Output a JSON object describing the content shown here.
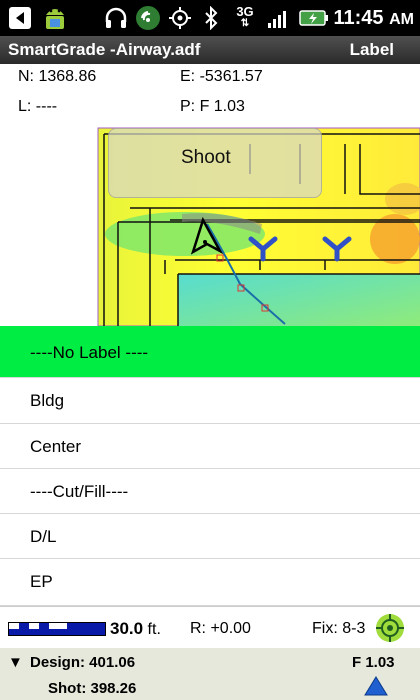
{
  "status_bar": {
    "time": "11:45",
    "time_suffix": "AM",
    "network": "3G",
    "icons": [
      "back-icon",
      "android-icon",
      "headphones-icon",
      "wifi-icon",
      "gps-target-icon",
      "bluetooth-icon",
      "signal-3g-icon",
      "battery-icon"
    ]
  },
  "app_bar": {
    "title": "SmartGrade -Airway.adf",
    "action": "Label"
  },
  "readout": {
    "n": "N: 1368.86",
    "e": "E: -5361.57",
    "l": "L:  ----",
    "p": "P:  F 1.03"
  },
  "map": {
    "shoot_label": "Shoot",
    "colors": {
      "yellow": "#ffff33",
      "green": "#7fe86a",
      "cyan": "#66e0c8",
      "orange": "#f7a82f",
      "marker_blue": "#3050c8"
    }
  },
  "label_list": {
    "items": [
      "----No Label ----",
      "Bldg",
      "Center",
      "----Cut/Fill----",
      "D/L",
      "EP"
    ],
    "selected_index": 0,
    "selected_color": "#00ee44"
  },
  "info": {
    "scale_value": "30.0",
    "scale_unit": "ft.",
    "r": "R: +0.00",
    "fix": "Fix: 8-3"
  },
  "bottom": {
    "design": "Design: 401.06",
    "shot": "Shot: 398.26",
    "p_value": "F 1.03"
  }
}
